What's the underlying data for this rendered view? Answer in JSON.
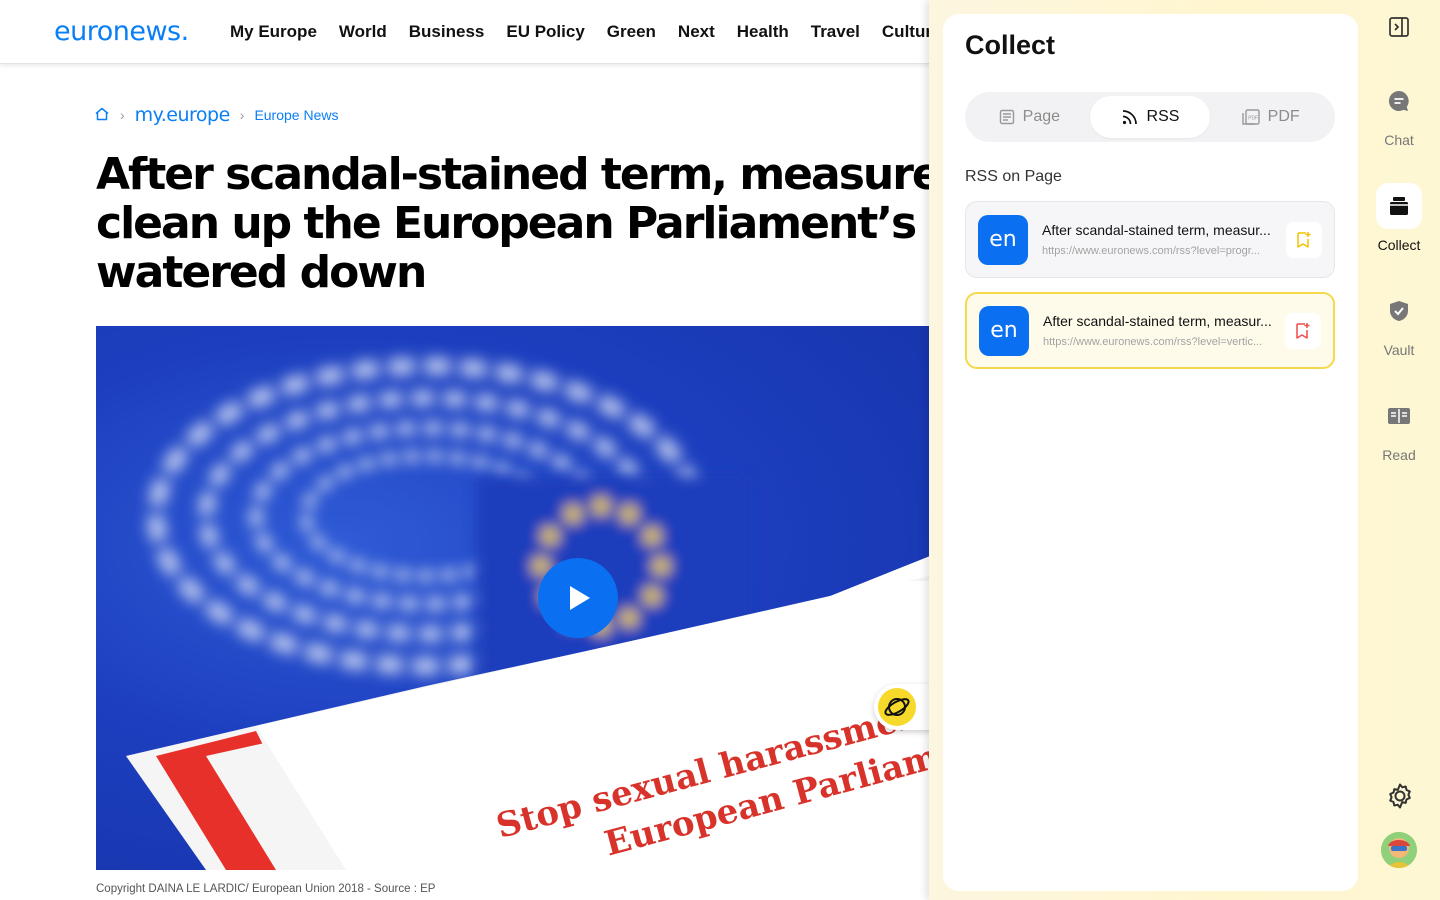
{
  "site": {
    "logo": "euronews.",
    "nav": [
      "My Europe",
      "World",
      "Business",
      "EU Policy",
      "Green",
      "Next",
      "Health",
      "Travel",
      "Culture"
    ]
  },
  "article": {
    "breadcrumb": {
      "section": "my.europe",
      "subsection": "Europe News"
    },
    "headline_lines": [
      "After scandal-stained term, measures t",
      "clean up the European Parliament’s act",
      "watered down"
    ],
    "image_text": [
      "Stop sexual harassment",
      "European Parliame"
    ],
    "caption": "Copyright DAINA LE LARDIC/ European Union 2018 - Source : EP"
  },
  "panel": {
    "title": "Collect",
    "tabs": [
      {
        "label": "Page",
        "icon": "page-icon",
        "active": false
      },
      {
        "label": "RSS",
        "icon": "rss-icon",
        "active": true
      },
      {
        "label": "PDF",
        "icon": "pdf-icon",
        "active": false
      }
    ],
    "section_label": "RSS on Page",
    "feeds": [
      {
        "icon_text": "en",
        "title": "After scandal-stained term, measur...",
        "url": "https://www.euronews.com/rss?level=progr...",
        "action_color": "#f2c200"
      },
      {
        "icon_text": "en",
        "title": "After scandal-stained term, measur...",
        "url": "https://www.euronews.com/rss?level=vertic...",
        "action_color": "#f04b4b"
      }
    ]
  },
  "rail": {
    "items": [
      {
        "label": "Chat",
        "icon": "chat-icon"
      },
      {
        "label": "Collect",
        "icon": "collect-icon"
      },
      {
        "label": "Vault",
        "icon": "vault-icon"
      },
      {
        "label": "Read",
        "icon": "read-icon"
      }
    ]
  },
  "colors": {
    "brand": "#0a7ff5",
    "accent_yellow": "#f5d94a",
    "play": "#0a6ff0"
  }
}
